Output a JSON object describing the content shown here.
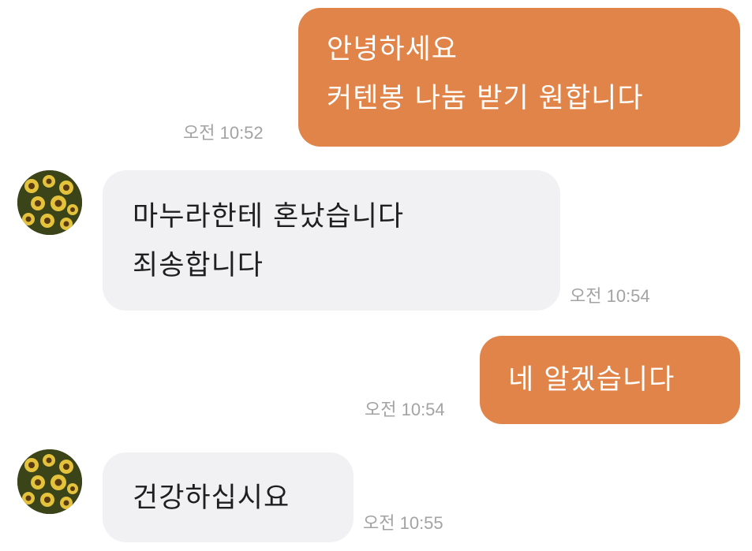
{
  "messages": [
    {
      "direction": "outgoing",
      "lines": [
        "안녕하세요",
        "커텐봉 나눔 받기 원합니다"
      ],
      "time": "오전 10:52"
    },
    {
      "direction": "incoming",
      "avatar": "sunflower-avatar",
      "lines": [
        "마누라한테 혼났습니다",
        "죄송합니다"
      ],
      "time": "오전 10:54"
    },
    {
      "direction": "outgoing",
      "lines": [
        "네 알겠습니다"
      ],
      "time": "오전 10:54"
    },
    {
      "direction": "incoming",
      "avatar": "sunflower-avatar",
      "lines": [
        "건강하십시요"
      ],
      "time": "오전 10:55"
    }
  ],
  "colors": {
    "outgoing_bubble": "#e0844a",
    "incoming_bubble": "#f1f1f4",
    "timestamp": "#a3a3a3",
    "background": "#ffffff"
  }
}
